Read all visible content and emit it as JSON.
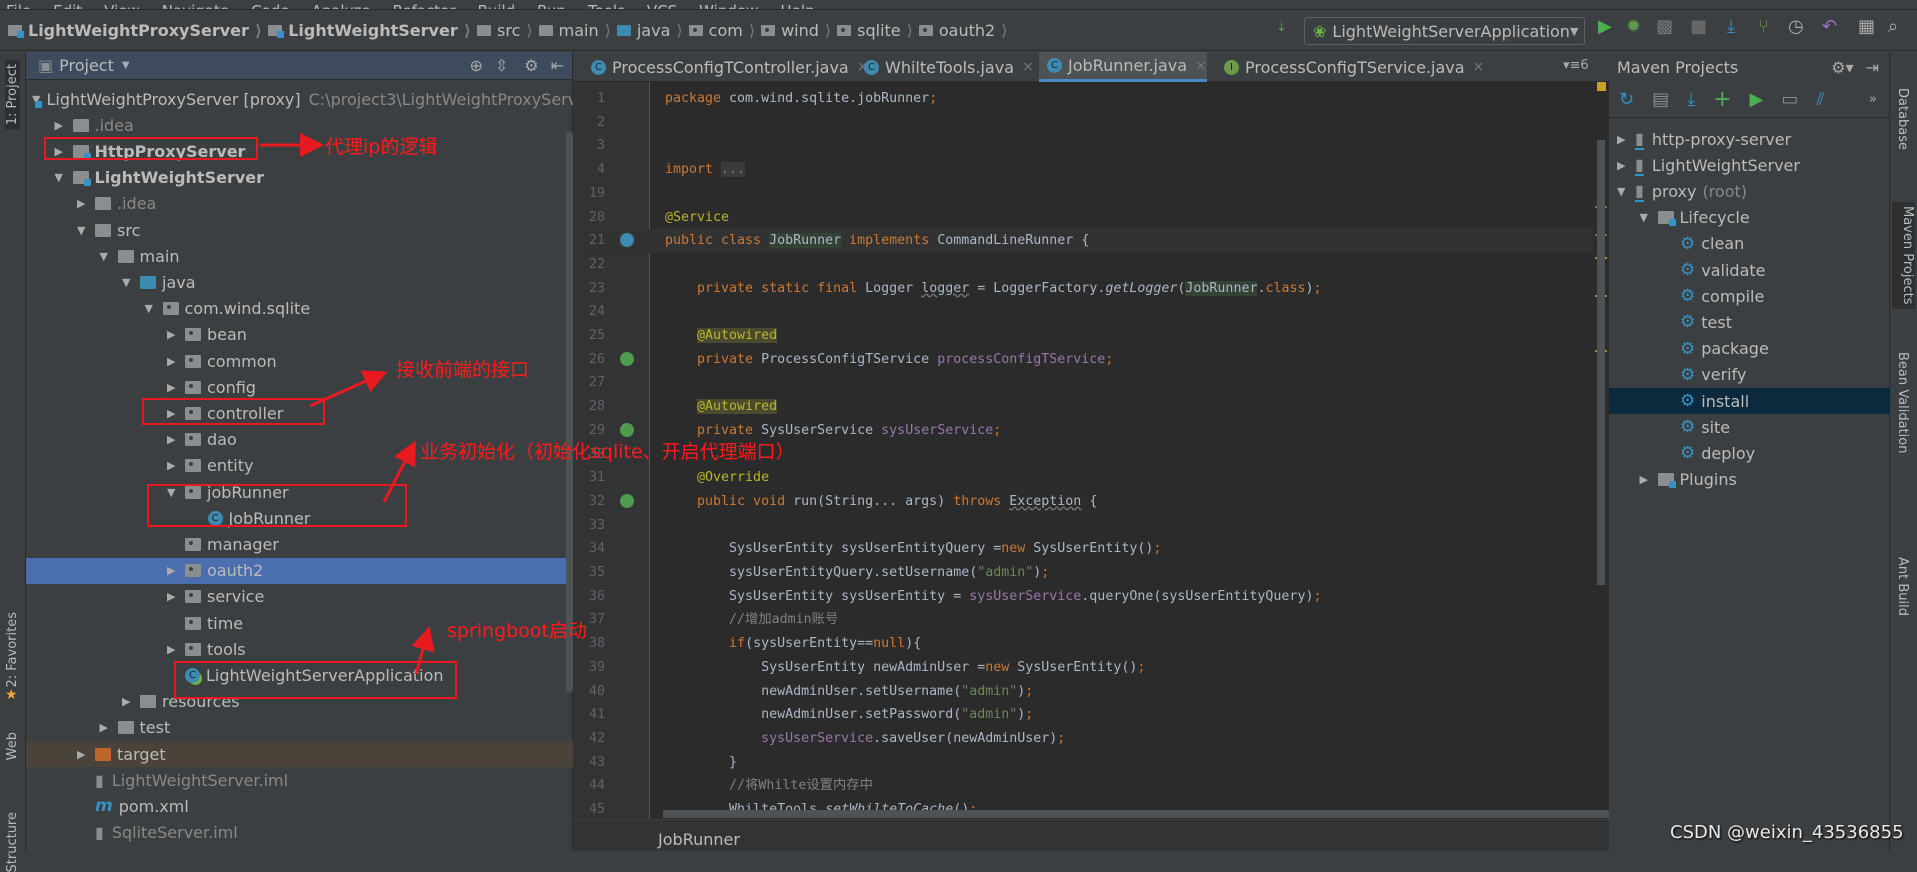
{
  "menu": [
    "File",
    "Edit",
    "View",
    "Navigate",
    "Code",
    "Analyze",
    "Refactor",
    "Build",
    "Run",
    "Tools",
    "VCS",
    "Window",
    "Help"
  ],
  "navbar": {
    "crumbs": [
      {
        "label": "LightWeightProxyServer",
        "icon": "module",
        "bold": true
      },
      {
        "label": "LightWeightServer",
        "icon": "module",
        "bold": true
      },
      {
        "label": "src",
        "icon": "folder"
      },
      {
        "label": "main",
        "icon": "folder"
      },
      {
        "label": "java",
        "icon": "source-folder"
      },
      {
        "label": "com",
        "icon": "package"
      },
      {
        "label": "wind",
        "icon": "package"
      },
      {
        "label": "sqlite",
        "icon": "package"
      },
      {
        "label": "oauth2",
        "icon": "package"
      }
    ],
    "run_config": "LightWeightServerApplication"
  },
  "left_strip": {
    "project": "1: Project",
    "favorites": "2: Favorites",
    "web": "Web",
    "structure": "Structure"
  },
  "project": {
    "title": "Project",
    "items": [
      {
        "label": "LightWeightProxyServer [proxy]",
        "hint": "C:\\project3\\LightWeightProxyServer",
        "depth": 0,
        "arrow": "down",
        "icon": "module"
      },
      {
        "label": ".idea",
        "depth": 1,
        "arrow": "right",
        "icon": "folder",
        "style": "dim"
      },
      {
        "label": "HttpProxyServer",
        "depth": 1,
        "arrow": "right",
        "icon": "module",
        "style": "bold"
      },
      {
        "label": "LightWeightServer",
        "depth": 1,
        "arrow": "down",
        "icon": "module",
        "style": "bold"
      },
      {
        "label": ".idea",
        "depth": 2,
        "arrow": "right",
        "icon": "folder",
        "style": "dim"
      },
      {
        "label": "src",
        "depth": 2,
        "arrow": "down",
        "icon": "folder"
      },
      {
        "label": "main",
        "depth": 3,
        "arrow": "down",
        "icon": "folder"
      },
      {
        "label": "java",
        "depth": 4,
        "arrow": "down",
        "icon": "source-folder"
      },
      {
        "label": "com.wind.sqlite",
        "depth": 5,
        "arrow": "down",
        "icon": "package"
      },
      {
        "label": "bean",
        "depth": 6,
        "arrow": "right",
        "icon": "package"
      },
      {
        "label": "common",
        "depth": 6,
        "arrow": "right",
        "icon": "package"
      },
      {
        "label": "config",
        "depth": 6,
        "arrow": "right",
        "icon": "package"
      },
      {
        "label": "controller",
        "depth": 6,
        "arrow": "right",
        "icon": "package"
      },
      {
        "label": "dao",
        "depth": 6,
        "arrow": "right",
        "icon": "package"
      },
      {
        "label": "entity",
        "depth": 6,
        "arrow": "right",
        "icon": "package"
      },
      {
        "label": "jobRunner",
        "depth": 6,
        "arrow": "down",
        "icon": "package"
      },
      {
        "label": "JobRunner",
        "depth": 7,
        "arrow": "none",
        "icon": "class"
      },
      {
        "label": "manager",
        "depth": 6,
        "arrow": "none",
        "icon": "package"
      },
      {
        "label": "oauth2",
        "depth": 6,
        "arrow": "right",
        "icon": "package",
        "selected": true
      },
      {
        "label": "service",
        "depth": 6,
        "arrow": "right",
        "icon": "package"
      },
      {
        "label": "time",
        "depth": 6,
        "arrow": "none",
        "icon": "package"
      },
      {
        "label": "tools",
        "depth": 6,
        "arrow": "right",
        "icon": "package"
      },
      {
        "label": "LightWeightServerApplication",
        "depth": 6,
        "arrow": "none",
        "icon": "spring-boot-class"
      },
      {
        "label": "resources",
        "depth": 4,
        "arrow": "right",
        "icon": "resources-folder"
      },
      {
        "label": "test",
        "depth": 3,
        "arrow": "right",
        "icon": "folder"
      },
      {
        "label": "target",
        "depth": 2,
        "arrow": "right",
        "icon": "excluded-folder",
        "excluded": true
      },
      {
        "label": "LightWeightServer.iml",
        "depth": 2,
        "arrow": "none",
        "icon": "iml-file",
        "style": "dim"
      },
      {
        "label": "pom.xml",
        "depth": 2,
        "arrow": "none",
        "icon": "maven-file"
      },
      {
        "label": "SqliteServer.iml",
        "depth": 2,
        "arrow": "none",
        "icon": "iml-file",
        "style": "dim"
      }
    ]
  },
  "editor": {
    "tabs": [
      {
        "label": "ProcessConfigTController.java",
        "icon": "class"
      },
      {
        "label": "WhilteTools.java",
        "icon": "class"
      },
      {
        "label": "JobRunner.java",
        "icon": "class",
        "active": true
      },
      {
        "label": "ProcessConfigTService.java",
        "icon": "interface"
      }
    ],
    "tab_overflow": "▾≡6",
    "footer": "JobRunner",
    "lines": [
      {
        "n": "1",
        "t": [
          [
            "kw",
            "package "
          ],
          [
            "plain",
            "com.wind.sqlite.jobRunner"
          ],
          [
            "kw",
            ";"
          ]
        ]
      },
      {
        "n": "2",
        "t": []
      },
      {
        "n": "3",
        "t": []
      },
      {
        "n": "4",
        "t": [
          [
            "kw",
            "import "
          ],
          [
            "fold",
            "..."
          ]
        ]
      },
      {
        "n": "19",
        "t": []
      },
      {
        "n": "20",
        "t": [
          [
            "ann",
            "@Service"
          ]
        ]
      },
      {
        "n": "21",
        "g": "bean",
        "caret": true,
        "t": [
          [
            "kw",
            "public class "
          ],
          [
            "hl",
            "JobRunner"
          ],
          [
            "kw",
            " implements "
          ],
          [
            "plain",
            "CommandLineRunner {"
          ]
        ]
      },
      {
        "n": "22",
        "t": []
      },
      {
        "n": "23",
        "t": [
          [
            "kw",
            "    private static final "
          ],
          [
            "plain",
            "Logger "
          ],
          [
            "warn",
            "logger"
          ],
          [
            "plain",
            " = LoggerFactory."
          ],
          [
            "it",
            "getLogger"
          ],
          [
            "plain",
            "("
          ],
          [
            "hl",
            "JobRunner"
          ],
          [
            "plain",
            "."
          ],
          [
            "kw",
            "class"
          ],
          [
            "plain",
            ")"
          ],
          [
            "kw",
            ";"
          ]
        ]
      },
      {
        "n": "24",
        "t": []
      },
      {
        "n": "25",
        "t": [
          [
            "plain",
            "    "
          ],
          [
            "annhl",
            "@Autowired"
          ]
        ]
      },
      {
        "n": "26",
        "g": "autowired",
        "t": [
          [
            "kw",
            "    private "
          ],
          [
            "plain",
            "ProcessConfigTService "
          ],
          [
            "field",
            "processConfigTService"
          ],
          [
            "kw",
            ";"
          ]
        ]
      },
      {
        "n": "27",
        "t": []
      },
      {
        "n": "28",
        "t": [
          [
            "plain",
            "    "
          ],
          [
            "annhl",
            "@Autowired"
          ]
        ]
      },
      {
        "n": "29",
        "g": "autowired",
        "t": [
          [
            "kw",
            "    private "
          ],
          [
            "plain",
            "SysUserService "
          ],
          [
            "field",
            "sysUserService"
          ],
          [
            "kw",
            ";"
          ]
        ]
      },
      {
        "n": "30",
        "t": []
      },
      {
        "n": "31",
        "t": [
          [
            "ann",
            "    @Override"
          ]
        ]
      },
      {
        "n": "32",
        "g": "implements",
        "t": [
          [
            "kw",
            "    public void "
          ],
          [
            "plain",
            "run(String... args) "
          ],
          [
            "kw",
            "throws "
          ],
          [
            "warn",
            "Exception"
          ],
          [
            "plain",
            " {"
          ]
        ]
      },
      {
        "n": "33",
        "t": []
      },
      {
        "n": "34",
        "t": [
          [
            "plain",
            "        SysUserEntity sysUserEntityQuery ="
          ],
          [
            "kw",
            "new "
          ],
          [
            "plain",
            "SysUserEntity()"
          ],
          [
            "kw",
            ";"
          ]
        ]
      },
      {
        "n": "35",
        "t": [
          [
            "plain",
            "        sysUserEntityQuery.setUsername("
          ],
          [
            "str",
            "\"admin\""
          ],
          [
            "plain",
            ")"
          ],
          [
            "kw",
            ";"
          ]
        ]
      },
      {
        "n": "36",
        "t": [
          [
            "plain",
            "        SysUserEntity sysUserEntity = "
          ],
          [
            "field",
            "sysUserService"
          ],
          [
            "plain",
            ".queryOne(sysUserEntityQuery)"
          ],
          [
            "kw",
            ";"
          ]
        ]
      },
      {
        "n": "37",
        "t": [
          [
            "cmt",
            "        //增加admin账号"
          ]
        ]
      },
      {
        "n": "38",
        "t": [
          [
            "kw",
            "        if"
          ],
          [
            "plain",
            "(sysUserEntity=="
          ],
          [
            "kw",
            "null"
          ],
          [
            "plain",
            "){"
          ]
        ]
      },
      {
        "n": "39",
        "t": [
          [
            "plain",
            "            SysUserEntity newAdminUser ="
          ],
          [
            "kw",
            "new "
          ],
          [
            "plain",
            "SysUserEntity()"
          ],
          [
            "kw",
            ";"
          ]
        ]
      },
      {
        "n": "40",
        "t": [
          [
            "plain",
            "            newAdminUser.setUsername("
          ],
          [
            "str",
            "\"admin\""
          ],
          [
            "plain",
            ")"
          ],
          [
            "kw",
            ";"
          ]
        ]
      },
      {
        "n": "41",
        "t": [
          [
            "plain",
            "            newAdminUser.setPassword("
          ],
          [
            "str",
            "\"admin\""
          ],
          [
            "plain",
            ")"
          ],
          [
            "kw",
            ";"
          ]
        ]
      },
      {
        "n": "42",
        "t": [
          [
            "field",
            "            sysUserService"
          ],
          [
            "plain",
            ".saveUser(newAdminUser)"
          ],
          [
            "kw",
            ";"
          ]
        ]
      },
      {
        "n": "43",
        "t": [
          [
            "plain",
            "        }"
          ]
        ]
      },
      {
        "n": "44",
        "t": [
          [
            "cmt",
            "        //将Whilte设置内存中"
          ]
        ]
      },
      {
        "n": "45",
        "t": [
          [
            "plain",
            "        WhilteTools."
          ],
          [
            "it",
            "setWhilteToCache"
          ],
          [
            "plain",
            "()"
          ],
          [
            "kw",
            ";"
          ]
        ]
      }
    ]
  },
  "maven": {
    "title": "Maven Projects",
    "items": [
      {
        "label": "http-proxy-server",
        "depth": 0,
        "arrow": "right",
        "icon": "maven-module"
      },
      {
        "label": "LightWeightServer",
        "depth": 0,
        "arrow": "right",
        "icon": "maven-module"
      },
      {
        "label": "proxy",
        "hint": "(root)",
        "depth": 0,
        "arrow": "down",
        "icon": "maven-module"
      },
      {
        "label": "Lifecycle",
        "depth": 1,
        "arrow": "down",
        "icon": "lifecycle-folder"
      },
      {
        "label": "clean",
        "depth": 2,
        "arrow": "none",
        "icon": "gear"
      },
      {
        "label": "validate",
        "depth": 2,
        "arrow": "none",
        "icon": "gear"
      },
      {
        "label": "compile",
        "depth": 2,
        "arrow": "none",
        "icon": "gear"
      },
      {
        "label": "test",
        "depth": 2,
        "arrow": "none",
        "icon": "gear"
      },
      {
        "label": "package",
        "depth": 2,
        "arrow": "none",
        "icon": "gear"
      },
      {
        "label": "verify",
        "depth": 2,
        "arrow": "none",
        "icon": "gear"
      },
      {
        "label": "install",
        "depth": 2,
        "arrow": "none",
        "icon": "gear",
        "selected": true
      },
      {
        "label": "site",
        "depth": 2,
        "arrow": "none",
        "icon": "gear"
      },
      {
        "label": "deploy",
        "depth": 2,
        "arrow": "none",
        "icon": "gear"
      },
      {
        "label": "Plugins",
        "depth": 1,
        "arrow": "right",
        "icon": "plugins-folder"
      }
    ]
  },
  "right_strip": {
    "database": "Database",
    "maven": "Maven Projects",
    "bean": "Bean Validation",
    "ant": "Ant Build"
  },
  "annotations": {
    "proxy": "代理ip的逻辑",
    "controller": "接收前端的接口",
    "init": "业务初始化（初始化sqlite、开启代理端口）",
    "boot": "springboot启动",
    "color": "#e8191f"
  },
  "watermark": "CSDN @weixin_43536855"
}
